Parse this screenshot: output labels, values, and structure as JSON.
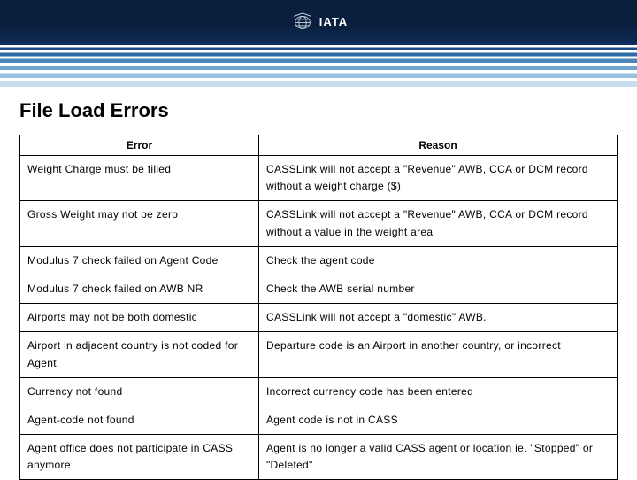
{
  "logo": {
    "text": "IATA"
  },
  "title": "File Load Errors",
  "table": {
    "headers": [
      "Error",
      "Reason"
    ],
    "rows": [
      {
        "error": "Weight Charge must be filled",
        "reason": "CASSLink will not accept a \"Revenue\" AWB, CCA or DCM record without a weight charge ($)"
      },
      {
        "error": "Gross Weight may not be zero",
        "reason": "CASSLink will not accept a \"Revenue\" AWB, CCA or DCM record without a value in the weight area"
      },
      {
        "error": "Modulus 7 check failed on Agent Code",
        "reason": "Check the agent code"
      },
      {
        "error": "Modulus 7 check failed on AWB NR",
        "reason": "Check the AWB serial number"
      },
      {
        "error": "Airports may not be both domestic",
        "reason": "CASSLink will not accept a \"domestic\" AWB."
      },
      {
        "error": "Airport in adjacent country is not coded for Agent",
        "reason": "Departure code is an Airport in another country, or incorrect"
      },
      {
        "error": "Currency not found",
        "reason": "Incorrect currency code has been entered"
      },
      {
        "error": "Agent-code not found",
        "reason": "Agent code is not in CASS"
      },
      {
        "error": "Agent office does not participate in CASS anymore",
        "reason": "Agent is no longer a valid CASS agent or location ie. \"Stopped\" or \"Deleted\""
      }
    ]
  }
}
